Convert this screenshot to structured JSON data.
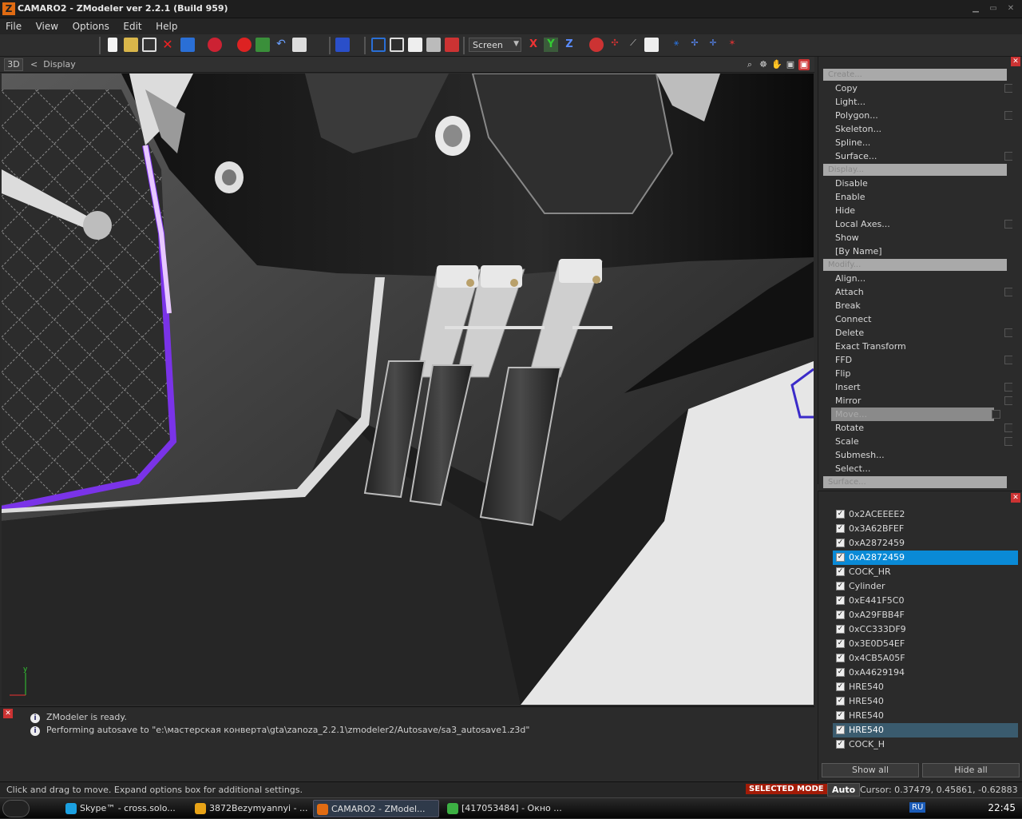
{
  "window": {
    "title": "CAMARO2 - ZModeler ver 2.2.1 (Build 959)",
    "app_icon": "Z"
  },
  "menu": [
    "File",
    "View",
    "Options",
    "Edit",
    "Help"
  ],
  "toolbar": {
    "screen_label": "Screen",
    "axes": [
      "X",
      "Y",
      "Z"
    ]
  },
  "viewport": {
    "mode": "3D",
    "breadcrumb_sep": "<",
    "breadcrumb": "Display"
  },
  "commands": {
    "groups": [
      {
        "header": "Create...",
        "items": [
          {
            "label": "Copy",
            "check": true
          },
          {
            "label": "Light...",
            "check": false
          },
          {
            "label": "Polygon...",
            "check": true
          },
          {
            "label": "Skeleton...",
            "check": false
          },
          {
            "label": "Spline...",
            "check": false
          },
          {
            "label": "Surface...",
            "check": true
          }
        ]
      },
      {
        "header": "Display...",
        "items": [
          {
            "label": "Disable",
            "check": false
          },
          {
            "label": "Enable",
            "check": false
          },
          {
            "label": "Hide",
            "check": false
          },
          {
            "label": "Local Axes...",
            "check": true
          },
          {
            "label": "Show",
            "check": false
          },
          {
            "label": "[By Name]",
            "check": false
          }
        ]
      },
      {
        "header": "Modify...",
        "items": [
          {
            "label": "Align...",
            "check": false
          },
          {
            "label": "Attach",
            "check": true
          },
          {
            "label": "Break",
            "check": false
          },
          {
            "label": "Connect",
            "check": false
          },
          {
            "label": "Delete",
            "check": true
          },
          {
            "label": "Exact Transform",
            "check": false
          },
          {
            "label": "FFD",
            "check": true
          },
          {
            "label": "Flip",
            "check": false
          },
          {
            "label": "Insert",
            "check": true
          },
          {
            "label": "Mirror",
            "check": true
          },
          {
            "label": "Move...",
            "check": true,
            "highlight": true
          },
          {
            "label": "Rotate",
            "check": true
          },
          {
            "label": "Scale",
            "check": true
          },
          {
            "label": "Submesh...",
            "check": false
          }
        ]
      },
      {
        "header": "",
        "items": [
          {
            "label": "Select...",
            "check": false
          }
        ]
      },
      {
        "header": "Surface...",
        "items": []
      }
    ]
  },
  "objects": {
    "items": [
      {
        "name": "0x2ACEEEE2",
        "state": ""
      },
      {
        "name": "0x3A62BFEF",
        "state": ""
      },
      {
        "name": "0xA2872459",
        "state": ""
      },
      {
        "name": "0xA2872459",
        "state": "sel"
      },
      {
        "name": "COCK_HR",
        "state": ""
      },
      {
        "name": "Cylinder",
        "state": ""
      },
      {
        "name": "0xE441F5C0",
        "state": ""
      },
      {
        "name": "0xA29FBB4F",
        "state": ""
      },
      {
        "name": "0xCC333DF9",
        "state": ""
      },
      {
        "name": "0x3E0D54EF",
        "state": ""
      },
      {
        "name": "0x4CB5A05F",
        "state": ""
      },
      {
        "name": "0xA4629194",
        "state": ""
      },
      {
        "name": "HRE540",
        "state": ""
      },
      {
        "name": "HRE540",
        "state": ""
      },
      {
        "name": "HRE540",
        "state": ""
      },
      {
        "name": "HRE540",
        "state": "sel2"
      },
      {
        "name": "COCK_H",
        "state": ""
      }
    ],
    "show_all": "Show all",
    "hide_all": "Hide all"
  },
  "console": {
    "messages": [
      "ZModeler is ready.",
      "Performing autosave to \"e:\\мастерская конверта\\gta\\zanoza_2.2.1\\zmodeler2/Autosave/sa3_autosave1.z3d\""
    ]
  },
  "status": {
    "hint": "Click and drag to move. Expand options box for additional settings.",
    "mode": "SELECTED MODE",
    "auto": "Auto",
    "cursor": "Cursor: 0.37479, 0.45861, -0.62883"
  },
  "taskbar": {
    "tasks": [
      {
        "label": "Skype™ - cross.solo...",
        "icon_color": "#1ba0e1"
      },
      {
        "label": "3872Bezymyannyi - ...",
        "icon_color": "#e8a317"
      },
      {
        "label": "CAMARO2 - ZModel...",
        "icon_color": "#e06b12",
        "active": true
      },
      {
        "label": "[417053484] - Окно ...",
        "icon_color": "#3cb043"
      }
    ],
    "lang": "RU",
    "clock": "22:45"
  }
}
